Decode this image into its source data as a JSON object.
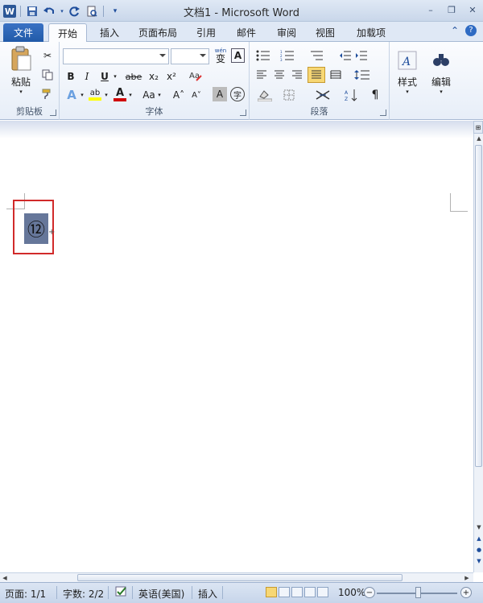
{
  "title_bar": {
    "title": "文档1 - Microsoft Word",
    "qat_icons": [
      "word-app-icon",
      "save-icon",
      "undo-icon",
      "redo-icon",
      "print-preview-icon",
      "customize-icon"
    ],
    "window_controls": [
      "minimize-icon",
      "restore-icon",
      "close-icon"
    ]
  },
  "tabs": {
    "file": "文件",
    "items": [
      "开始",
      "插入",
      "页面布局",
      "引用",
      "邮件",
      "审阅",
      "视图",
      "加载项"
    ],
    "active": "开始"
  },
  "ribbon": {
    "clipboard": {
      "paste": "粘贴",
      "label": "剪贴板"
    },
    "font": {
      "label": "字体",
      "font_name": "",
      "font_size": "",
      "phonetic_glyph": "wén",
      "phonetic_char": "变",
      "border_char": "A",
      "bold": "B",
      "italic": "I",
      "underline": "U",
      "strike": "abe",
      "subscript": "x₂",
      "superscript": "x²",
      "text_effect": "A",
      "highlight": "ab",
      "font_color": "A",
      "change_case": "Aa",
      "grow": "A˄",
      "shrink": "A˅",
      "shading": "A",
      "enclose": "字"
    },
    "paragraph": {
      "label": "段落"
    },
    "styles": {
      "label": "样式"
    },
    "editing": {
      "label": "编辑"
    }
  },
  "document": {
    "selected_text": "⑫"
  },
  "status_bar": {
    "page": "页面: 1/1",
    "word_count": "字数: 2/2",
    "language": "英语(美国)",
    "insert_mode": "插入",
    "zoom": "100%",
    "zoom_level": 100
  },
  "colors": {
    "accent": "#2b5797",
    "highlight_box": "#d12a2a",
    "selection": "#66779a",
    "font_color_bar": "#d00000",
    "highlight_bar": "#ffff00"
  }
}
